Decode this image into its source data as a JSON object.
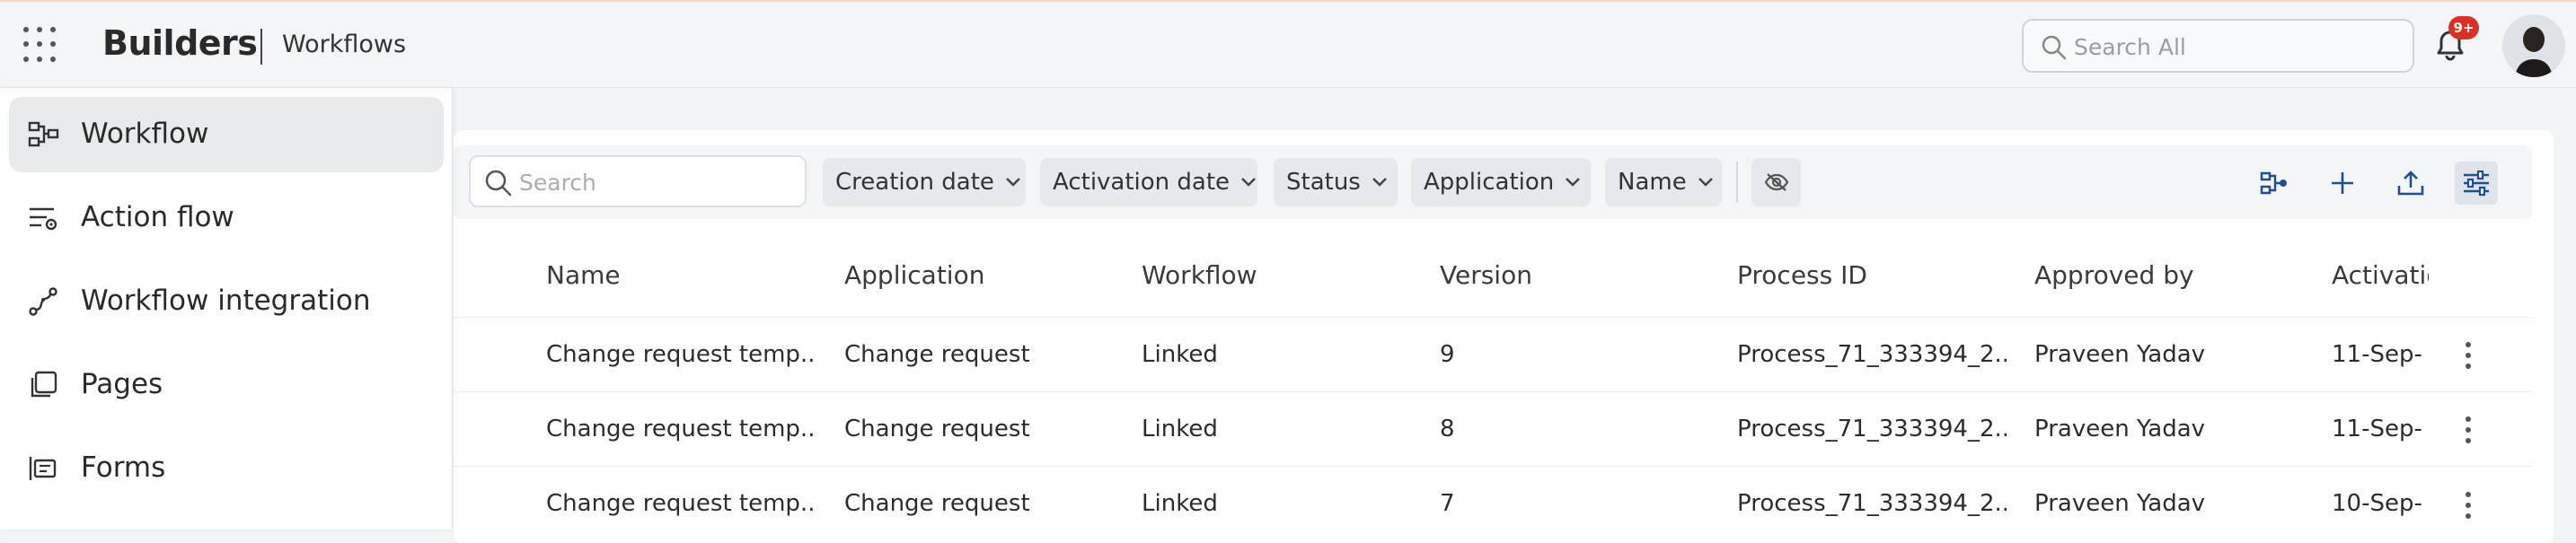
{
  "header": {
    "app_name": "Builders",
    "breadcrumb": "Workflows",
    "search_placeholder": "Search All",
    "notification_badge": "9+"
  },
  "sidebar": {
    "items": [
      {
        "label": "Workflow",
        "icon": "workflow-icon",
        "active": true
      },
      {
        "label": "Action flow",
        "icon": "action-flow-icon",
        "active": false
      },
      {
        "label": "Workflow integration",
        "icon": "workflow-integration-icon",
        "active": false
      },
      {
        "label": "Pages",
        "icon": "pages-icon",
        "active": false
      },
      {
        "label": "Forms",
        "icon": "forms-icon",
        "active": false
      }
    ]
  },
  "toolbar": {
    "search_placeholder": "Search",
    "filters": [
      "Creation date",
      "Activation date",
      "Status",
      "Application",
      "Name"
    ],
    "actions": [
      "flow-builder-icon",
      "add-icon",
      "upload-icon",
      "filter-settings-icon"
    ]
  },
  "table": {
    "columns": [
      "Name",
      "Application",
      "Workflow",
      "Version",
      "Process ID",
      "Approved by",
      "Activatio"
    ],
    "rows": [
      {
        "name": "Change request temp...",
        "application": "Change request",
        "workflow": "Linked",
        "version": "9",
        "process_id": "Process_71_333394_2...",
        "approved_by": "Praveen Yadav",
        "activation": "11-Sep-"
      },
      {
        "name": "Change request temp...",
        "application": "Change request",
        "workflow": "Linked",
        "version": "8",
        "process_id": "Process_71_333394_2...",
        "approved_by": "Praveen Yadav",
        "activation": "11-Sep-"
      },
      {
        "name": "Change request temp...",
        "application": "Change request",
        "workflow": "Linked",
        "version": "7",
        "process_id": "Process_71_333394_2...",
        "approved_by": "Praveen Yadav",
        "activation": "10-Sep-"
      }
    ]
  },
  "colors": {
    "accent": "#1f4f8f",
    "badge": "#d93025",
    "sidebar_active": "#e9eaeb"
  }
}
